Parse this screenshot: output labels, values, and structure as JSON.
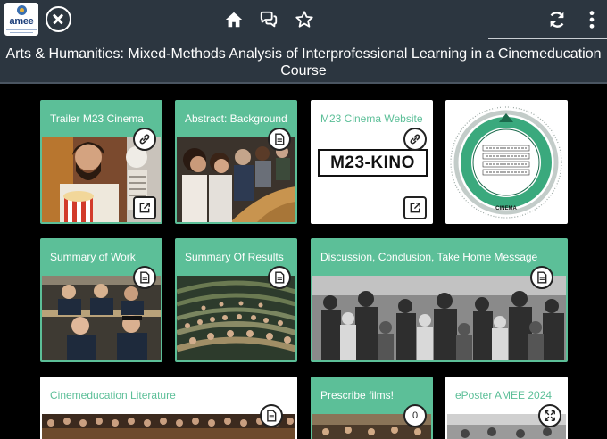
{
  "header": {
    "logo_text": "amee",
    "title": "Arts & Humanities: Mixed-Methods Analysis of Interprofessional Learning in a Cinemeducation Course",
    "icons": [
      "home-icon",
      "chat-bubbles-icon",
      "star-icon",
      "refresh-icon",
      "more-vertical-icon"
    ]
  },
  "tiles": [
    {
      "title": "Trailer M23 Cinema",
      "icon": "link-icon",
      "action_icon": "external-link-icon"
    },
    {
      "title": "Abstract: Background",
      "icon": "document-icon"
    },
    {
      "title": "M23 Cinema Website",
      "icon": "link-icon",
      "action_icon": "external-link-icon",
      "logo_text": "M23-KINO"
    },
    {
      "title": "",
      "diagram_label": "CINEMA"
    },
    {
      "title": "Summary of Work",
      "icon": "document-icon"
    },
    {
      "title": "Summary Of Results",
      "icon": "document-icon"
    },
    {
      "title": "Discussion, Conclusion, Take Home Message",
      "icon": "document-icon"
    },
    {
      "title": "Cinemeducation Literature",
      "icon": "document-icon"
    },
    {
      "title": "Prescribe films!",
      "counter": "0"
    },
    {
      "title": "ePoster AMEE 2024",
      "icon": "expand-icon"
    }
  ],
  "colors": {
    "topbar": "#2c3640",
    "accent": "#5cbf98",
    "background": "#000000"
  }
}
